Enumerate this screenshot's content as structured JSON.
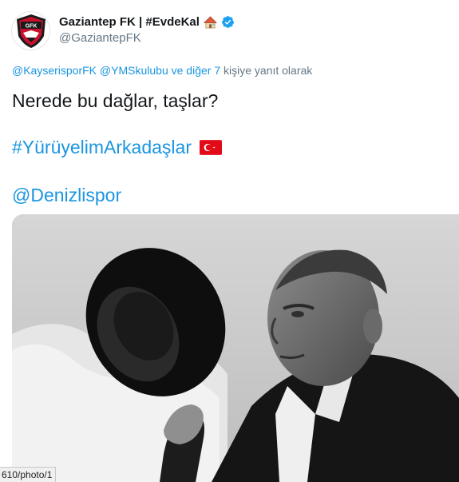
{
  "account": {
    "display_name": "Gaziantep FK | #EvdeKal",
    "handle": "@GaziantepFK",
    "avatar_badge_text": "GFK",
    "verified": true
  },
  "reply": {
    "mention1": "@KayserisporFK",
    "mention2": "@YMSkulubu",
    "and_others": "ve diğer 7",
    "suffix": "kişiye yanıt olarak"
  },
  "tweet": {
    "line1": "Nerede bu dağlar, taşlar?",
    "hashtag": "#YürüyelimArkadaşlar",
    "mention": "@Denizlispor"
  },
  "media": {
    "icon": "photo",
    "description_hidden": true
  },
  "status_bar": {
    "url": "610/photo/1"
  },
  "colors": {
    "link": "#1b95e0",
    "secondary": "#657786",
    "club_red": "#c8102e"
  }
}
